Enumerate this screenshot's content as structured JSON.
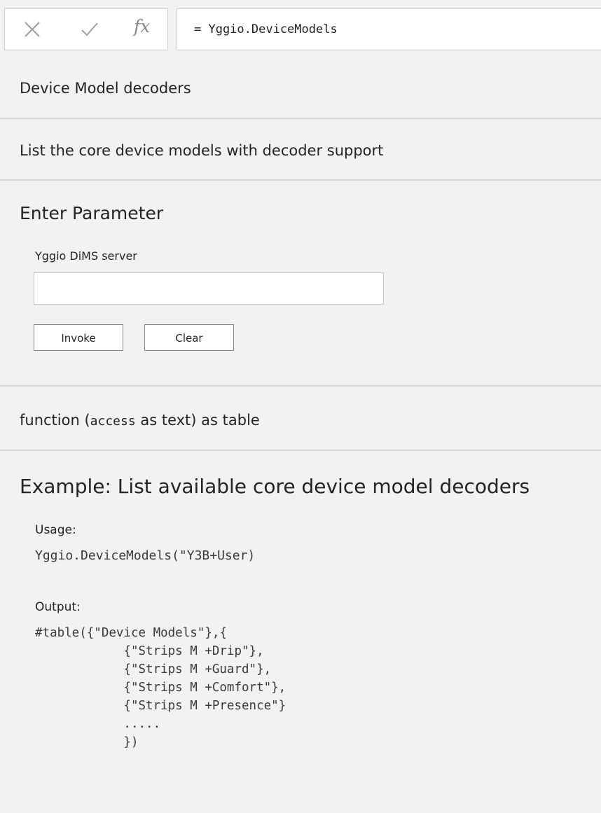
{
  "formula_bar": {
    "cancel_icon": "x-icon",
    "confirm_icon": "check-icon",
    "fx_label": "fx",
    "formula": "= Yggio.DeviceModels"
  },
  "function_title": "Device Model decoders",
  "description": "List the core device models with decoder support",
  "parameters": {
    "heading": "Enter Parameter",
    "field_label": "Yggio DiMS server",
    "field_value": "",
    "invoke_label": "Invoke",
    "clear_label": "Clear"
  },
  "signature": {
    "prefix": "function (",
    "param_name": "access",
    "suffix": " as text) as table"
  },
  "example": {
    "title": "Example: List available core device model decoders",
    "usage_label": "Usage:",
    "usage_code": "Yggio.DeviceModels(\"Y3B+User)",
    "output_label": "Output:",
    "output_code": "#table({\"Device Models\"},{\n            {\"Strips M +Drip\"},\n            {\"Strips M +Guard\"},\n            {\"Strips M +Comfort\"},\n            {\"Strips M +Presence\"}\n            .....\n            })"
  }
}
